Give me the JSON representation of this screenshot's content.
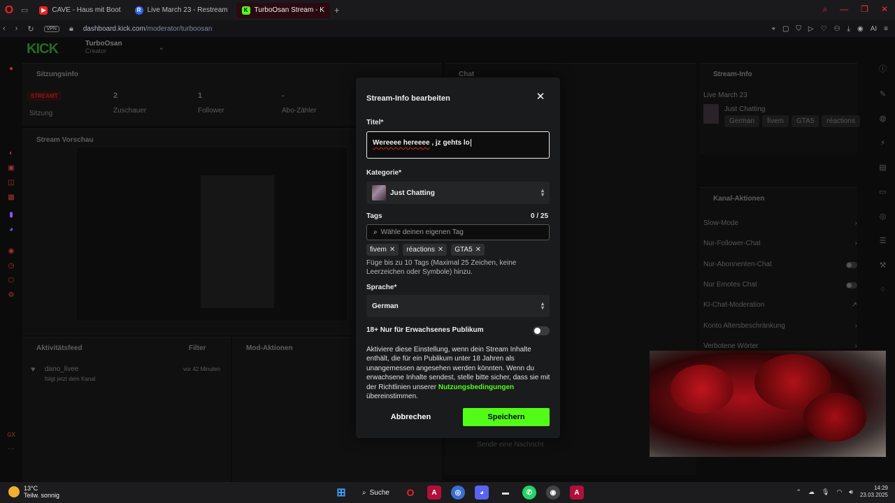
{
  "browser": {
    "tabs": [
      {
        "label": "CAVE - Haus mit Boot",
        "icon": "youtube-icon",
        "active": false
      },
      {
        "label": "Live March 23 - Restream",
        "icon": "restream-icon",
        "active": false
      },
      {
        "label": "TurboOsan Stream - K",
        "icon": "kick-icon",
        "active": true
      }
    ],
    "url_host": "dashboard.kick.com",
    "url_path": "/moderator/turboosan",
    "vpn": "VPN",
    "ai_label": "AI"
  },
  "dashboard": {
    "logo": "KICK",
    "channel_name": "TurboOsan",
    "channel_role": "Creator",
    "session": {
      "title": "Sitzungsinfo",
      "status_badge": "STREAMT",
      "status_label": "Sitzung",
      "viewers_value": "2",
      "viewers_label": "Zuschauer",
      "followers_value": "1",
      "followers_label": "Follower",
      "subs_value": "-",
      "subs_label": "Abo-Zähler"
    },
    "preview_title": "Stream Vorschau",
    "chat_title": "Chat",
    "chat_placeholder": "Sende eine Nachricht",
    "activity": {
      "title": "Aktivitätsfeed",
      "filter": "Filter",
      "item_user": "dano_livee",
      "item_time": "vor 42 Minuten",
      "item_text": "folgt jetzt dem Kanal"
    },
    "mod_title": "Mod-Aktionen",
    "stream_info": {
      "title": "Stream-Info",
      "stream_title": "Live March 23",
      "category": "Just Chatting",
      "tags": [
        "German",
        "fivem",
        "GTA5",
        "réactions"
      ]
    },
    "channel_actions": {
      "title": "Kanal-Aktionen",
      "items": [
        {
          "label": "Slow-Mode",
          "control": "arrow"
        },
        {
          "label": "Nur-Follower-Chat",
          "control": "arrow"
        },
        {
          "label": "Nur-Abonnenten-Chat",
          "control": "toggle"
        },
        {
          "label": "Nur Emotes Chat",
          "control": "toggle"
        },
        {
          "label": "KI-Chat-Moderation",
          "control": "external"
        },
        {
          "label": "Konto Altersbeschränkung",
          "control": "arrow"
        },
        {
          "label": "Verbotene Wörter",
          "control": "arrow"
        }
      ]
    }
  },
  "modal": {
    "title": "Stream-Info bearbeiten",
    "title_label": "Titel*",
    "title_value_misspelled": "Wereeee hereeee",
    "title_value_rest": " , jz gehts lo",
    "category_label": "Kategorie*",
    "category_value": "Just Chatting",
    "tags_label": "Tags",
    "tags_counter": "0 / 25",
    "tags_placeholder": "Wähle deinen eigenen Tag",
    "tags": [
      "fivem",
      "réactions",
      "GTA5"
    ],
    "tags_help": "Füge bis zu 10 Tags (Maximal 25 Zeichen, keine Leerzeichen oder Symbole) hinzu.",
    "language_label": "Sprache*",
    "language_value": "German",
    "mature_label": "18+ Nur für Erwachsenes Publikum",
    "mature_enabled": false,
    "mature_desc": "Aktiviere diese Einstellung, wenn dein Stream Inhalte enthält, die für ein Publikum unter 18 Jahren als unangemessen angesehen werden könnten. Wenn du erwachsene Inhalte sendest, stelle bitte sicher, dass sie mit der Richtlinien unserer",
    "mature_link": "Nutzungsbedingungen",
    "mature_desc_end": "übereinstimmen.",
    "cancel_label": "Abbrechen",
    "save_label": "Speichern",
    "accent_color": "#53fc18"
  },
  "taskbar": {
    "temperature": "13°C",
    "weather": "Teilw. sonnig",
    "search_label": "Suche",
    "time": "14:29",
    "date": "23.03.2025"
  }
}
